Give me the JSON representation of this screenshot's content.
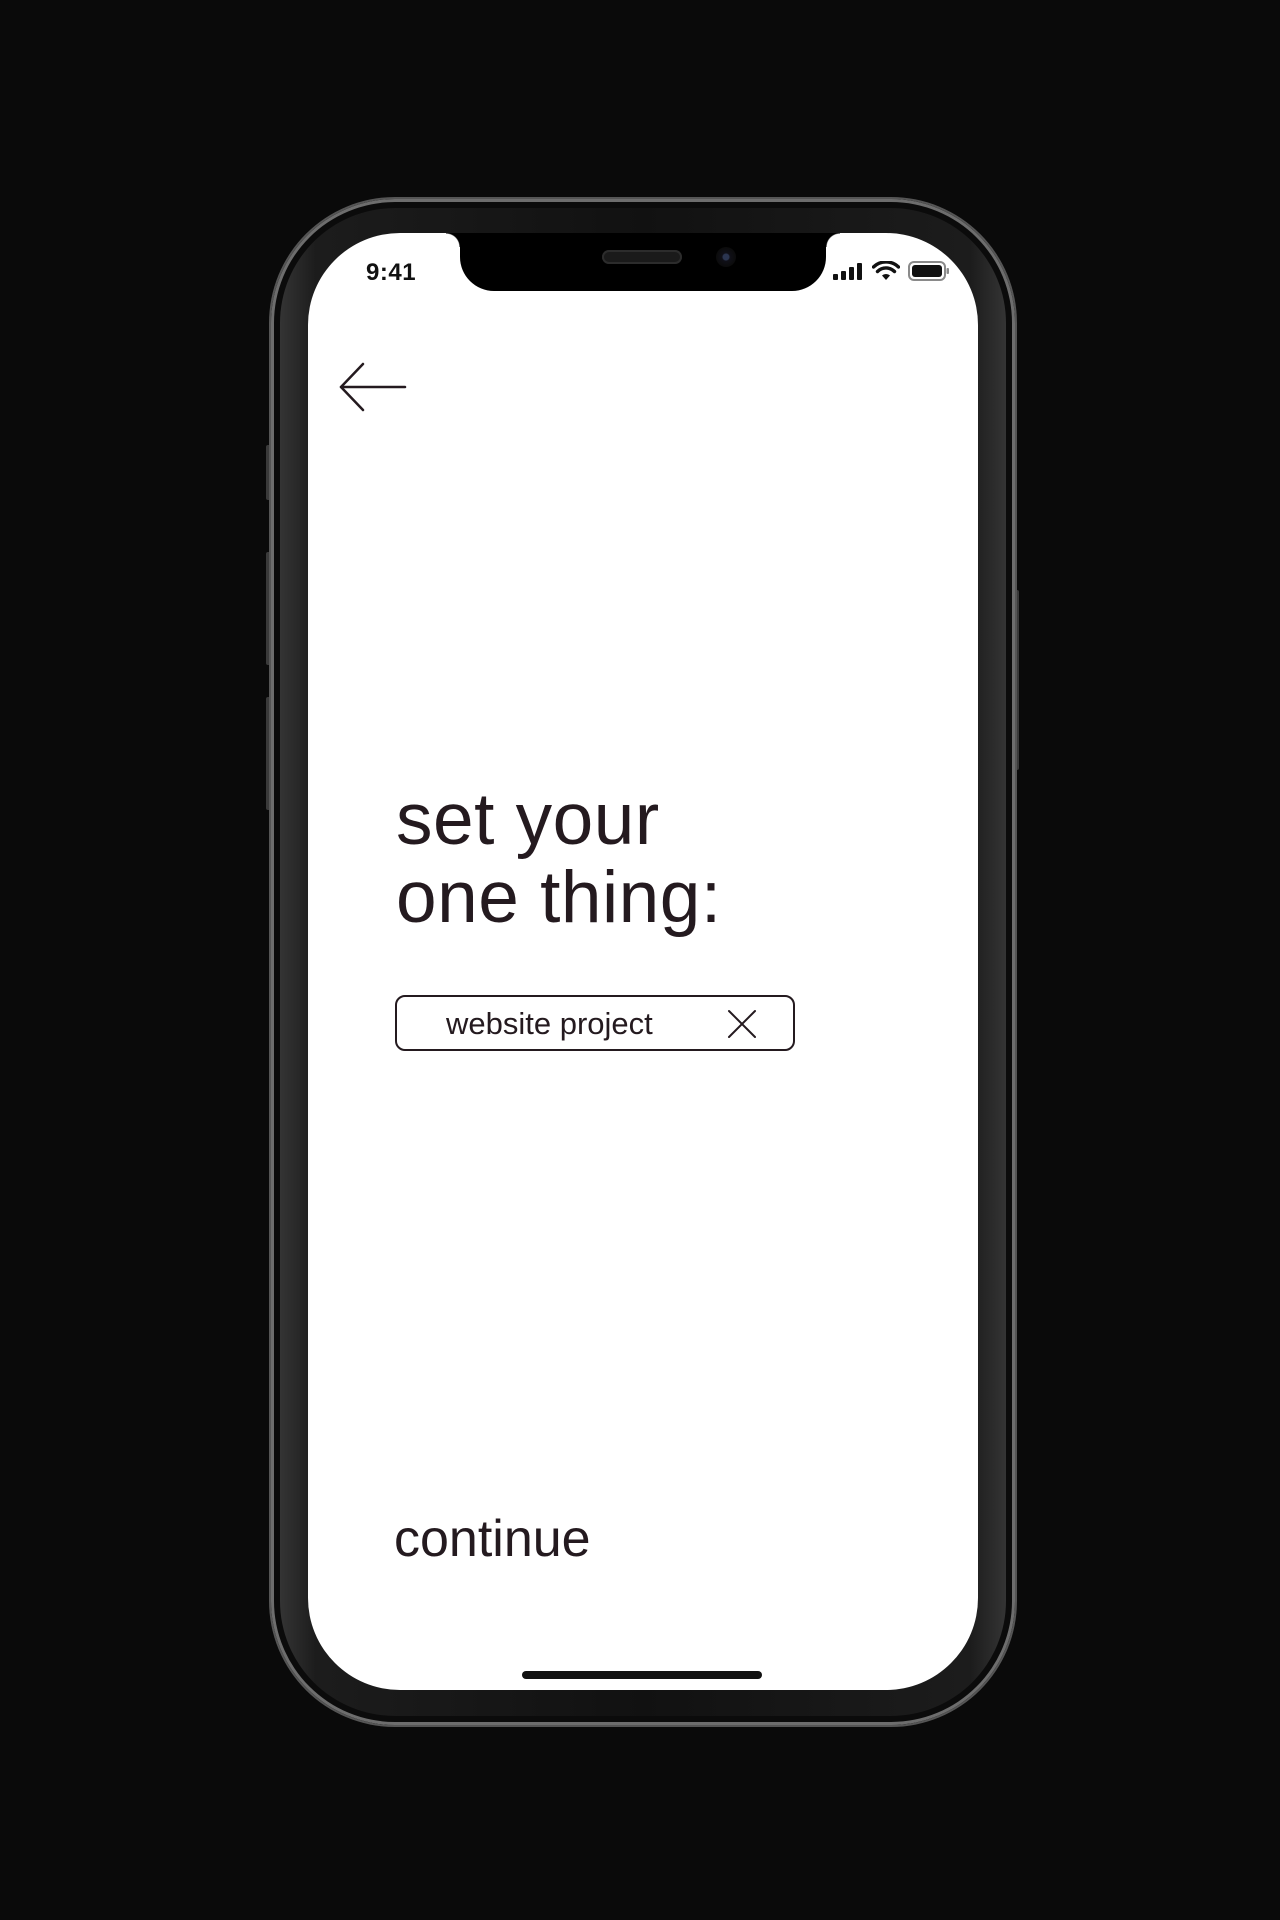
{
  "status_bar": {
    "time": "9:41",
    "icons": [
      "cellular-signal-icon",
      "wifi-icon",
      "battery-icon"
    ]
  },
  "nav": {
    "back_icon": "arrow-left-icon"
  },
  "main": {
    "title_line1": "set your",
    "title_line2": "one thing:",
    "chip": {
      "label": "website project",
      "close_icon": "close-icon"
    }
  },
  "footer": {
    "continue_label": "continue"
  },
  "colors": {
    "background": "#0a0a0a",
    "screen": "#ffffff",
    "text": "#241a1f"
  }
}
